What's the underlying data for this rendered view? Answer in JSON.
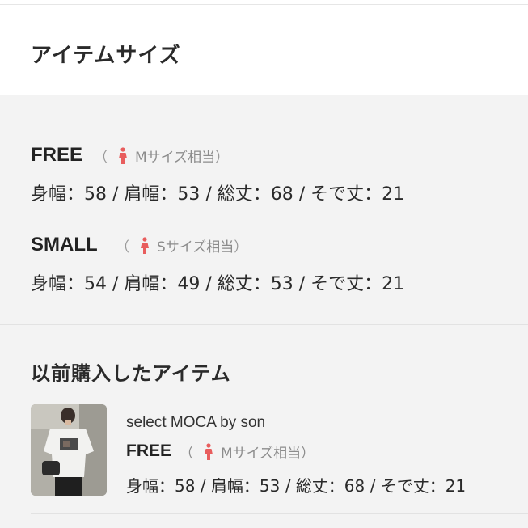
{
  "section": {
    "title": "アイテムサイズ"
  },
  "sizes": [
    {
      "name": "FREE",
      "open": "（",
      "fit": "Mサイズ相当",
      "close": "）",
      "measurements": "身幅：58 / 肩幅：53 / 総丈：68 / そで丈：21"
    },
    {
      "name": "SMALL",
      "open": "（",
      "fit": "Sサイズ相当",
      "close": "）",
      "measurements": "身幅：54 / 肩幅：49 / 総丈：53 / そで丈：21"
    }
  ],
  "history": {
    "title": "以前購入したアイテム",
    "item": {
      "brand": "select MOCA by son",
      "size": "FREE",
      "open": "（",
      "fit": "Mサイズ相当",
      "close": "）",
      "measurements": "身幅：58 / 肩幅：53 / 総丈：68 / そで丈：21"
    }
  },
  "colors": {
    "panel_bg": "#f3f3f3",
    "person_icon": "#e85d5d",
    "muted_text": "#8c8c8c"
  },
  "icons": {
    "fit_icon": "person-female-icon"
  }
}
